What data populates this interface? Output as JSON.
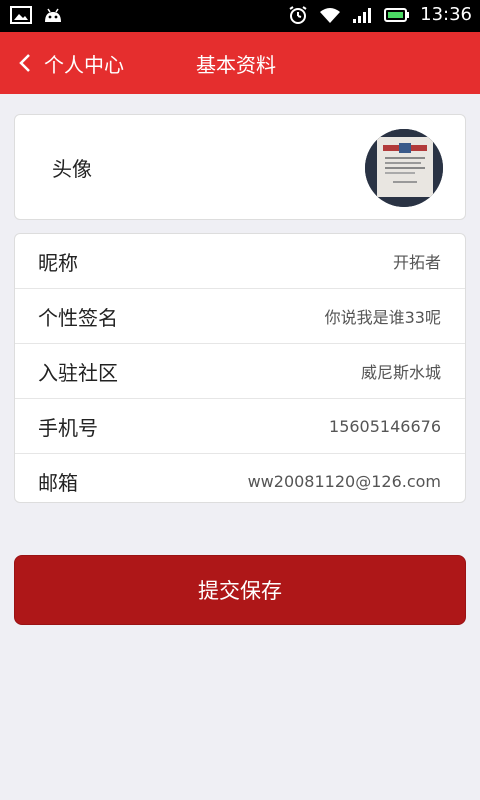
{
  "status_bar": {
    "time": "13:36"
  },
  "header": {
    "back_label": "个人中心",
    "title": "基本资料"
  },
  "avatar_section": {
    "label": "头像"
  },
  "profile": {
    "rows": [
      {
        "label": "昵称",
        "value": "开拓者"
      },
      {
        "label": "个性签名",
        "value": "你说我是谁33呢"
      },
      {
        "label": "入驻社区",
        "value": "威尼斯水城"
      },
      {
        "label": "手机号",
        "value": "15605146676"
      },
      {
        "label": "邮箱",
        "value": "ww20081120@126.com"
      }
    ]
  },
  "actions": {
    "save_label": "提交保存"
  },
  "colors": {
    "nav_red": "#e52e2e",
    "button_red": "#ae1718",
    "background": "#efeff4"
  }
}
